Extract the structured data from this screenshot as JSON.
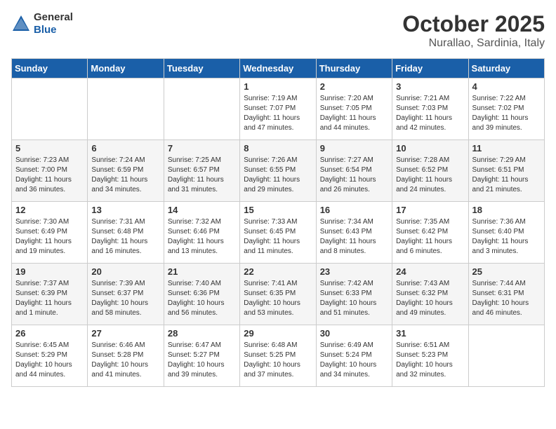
{
  "header": {
    "logo_general": "General",
    "logo_blue": "Blue",
    "month": "October 2025",
    "location": "Nurallao, Sardinia, Italy"
  },
  "weekdays": [
    "Sunday",
    "Monday",
    "Tuesday",
    "Wednesday",
    "Thursday",
    "Friday",
    "Saturday"
  ],
  "weeks": [
    [
      {
        "day": "",
        "info": ""
      },
      {
        "day": "",
        "info": ""
      },
      {
        "day": "",
        "info": ""
      },
      {
        "day": "1",
        "info": "Sunrise: 7:19 AM\nSunset: 7:07 PM\nDaylight: 11 hours\nand 47 minutes."
      },
      {
        "day": "2",
        "info": "Sunrise: 7:20 AM\nSunset: 7:05 PM\nDaylight: 11 hours\nand 44 minutes."
      },
      {
        "day": "3",
        "info": "Sunrise: 7:21 AM\nSunset: 7:03 PM\nDaylight: 11 hours\nand 42 minutes."
      },
      {
        "day": "4",
        "info": "Sunrise: 7:22 AM\nSunset: 7:02 PM\nDaylight: 11 hours\nand 39 minutes."
      }
    ],
    [
      {
        "day": "5",
        "info": "Sunrise: 7:23 AM\nSunset: 7:00 PM\nDaylight: 11 hours\nand 36 minutes."
      },
      {
        "day": "6",
        "info": "Sunrise: 7:24 AM\nSunset: 6:59 PM\nDaylight: 11 hours\nand 34 minutes."
      },
      {
        "day": "7",
        "info": "Sunrise: 7:25 AM\nSunset: 6:57 PM\nDaylight: 11 hours\nand 31 minutes."
      },
      {
        "day": "8",
        "info": "Sunrise: 7:26 AM\nSunset: 6:55 PM\nDaylight: 11 hours\nand 29 minutes."
      },
      {
        "day": "9",
        "info": "Sunrise: 7:27 AM\nSunset: 6:54 PM\nDaylight: 11 hours\nand 26 minutes."
      },
      {
        "day": "10",
        "info": "Sunrise: 7:28 AM\nSunset: 6:52 PM\nDaylight: 11 hours\nand 24 minutes."
      },
      {
        "day": "11",
        "info": "Sunrise: 7:29 AM\nSunset: 6:51 PM\nDaylight: 11 hours\nand 21 minutes."
      }
    ],
    [
      {
        "day": "12",
        "info": "Sunrise: 7:30 AM\nSunset: 6:49 PM\nDaylight: 11 hours\nand 19 minutes."
      },
      {
        "day": "13",
        "info": "Sunrise: 7:31 AM\nSunset: 6:48 PM\nDaylight: 11 hours\nand 16 minutes."
      },
      {
        "day": "14",
        "info": "Sunrise: 7:32 AM\nSunset: 6:46 PM\nDaylight: 11 hours\nand 13 minutes."
      },
      {
        "day": "15",
        "info": "Sunrise: 7:33 AM\nSunset: 6:45 PM\nDaylight: 11 hours\nand 11 minutes."
      },
      {
        "day": "16",
        "info": "Sunrise: 7:34 AM\nSunset: 6:43 PM\nDaylight: 11 hours\nand 8 minutes."
      },
      {
        "day": "17",
        "info": "Sunrise: 7:35 AM\nSunset: 6:42 PM\nDaylight: 11 hours\nand 6 minutes."
      },
      {
        "day": "18",
        "info": "Sunrise: 7:36 AM\nSunset: 6:40 PM\nDaylight: 11 hours\nand 3 minutes."
      }
    ],
    [
      {
        "day": "19",
        "info": "Sunrise: 7:37 AM\nSunset: 6:39 PM\nDaylight: 11 hours\nand 1 minute."
      },
      {
        "day": "20",
        "info": "Sunrise: 7:39 AM\nSunset: 6:37 PM\nDaylight: 10 hours\nand 58 minutes."
      },
      {
        "day": "21",
        "info": "Sunrise: 7:40 AM\nSunset: 6:36 PM\nDaylight: 10 hours\nand 56 minutes."
      },
      {
        "day": "22",
        "info": "Sunrise: 7:41 AM\nSunset: 6:35 PM\nDaylight: 10 hours\nand 53 minutes."
      },
      {
        "day": "23",
        "info": "Sunrise: 7:42 AM\nSunset: 6:33 PM\nDaylight: 10 hours\nand 51 minutes."
      },
      {
        "day": "24",
        "info": "Sunrise: 7:43 AM\nSunset: 6:32 PM\nDaylight: 10 hours\nand 49 minutes."
      },
      {
        "day": "25",
        "info": "Sunrise: 7:44 AM\nSunset: 6:31 PM\nDaylight: 10 hours\nand 46 minutes."
      }
    ],
    [
      {
        "day": "26",
        "info": "Sunrise: 6:45 AM\nSunset: 5:29 PM\nDaylight: 10 hours\nand 44 minutes."
      },
      {
        "day": "27",
        "info": "Sunrise: 6:46 AM\nSunset: 5:28 PM\nDaylight: 10 hours\nand 41 minutes."
      },
      {
        "day": "28",
        "info": "Sunrise: 6:47 AM\nSunset: 5:27 PM\nDaylight: 10 hours\nand 39 minutes."
      },
      {
        "day": "29",
        "info": "Sunrise: 6:48 AM\nSunset: 5:25 PM\nDaylight: 10 hours\nand 37 minutes."
      },
      {
        "day": "30",
        "info": "Sunrise: 6:49 AM\nSunset: 5:24 PM\nDaylight: 10 hours\nand 34 minutes."
      },
      {
        "day": "31",
        "info": "Sunrise: 6:51 AM\nSunset: 5:23 PM\nDaylight: 10 hours\nand 32 minutes."
      },
      {
        "day": "",
        "info": ""
      }
    ]
  ]
}
